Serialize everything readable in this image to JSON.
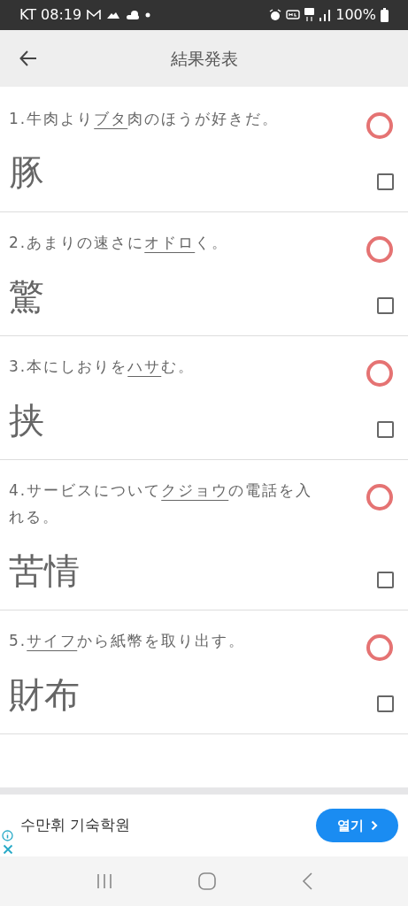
{
  "status_bar": {
    "carrier_time": "KT 08:19",
    "battery": "100%"
  },
  "header": {
    "title": "結果発表"
  },
  "questions": [
    {
      "number": "1.",
      "before": "牛肉より",
      "underlined": "ブタ",
      "after": "肉のほうが好きだ。",
      "answer": "豚",
      "correct": true,
      "checked": false
    },
    {
      "number": "2.",
      "before": "あまりの速さに",
      "underlined": "オドロ",
      "after": "く。",
      "answer": "驚",
      "correct": true,
      "checked": false
    },
    {
      "number": "3.",
      "before": "本にしおりを",
      "underlined": "ハサ",
      "after": "む。",
      "answer": "挟",
      "correct": true,
      "checked": false
    },
    {
      "number": "4.",
      "before": "サービスについて",
      "underlined": "クジョウ",
      "after": "の電話を入れる。",
      "answer": "苦情",
      "correct": true,
      "checked": false
    },
    {
      "number": "5.",
      "underlined": "サイフ",
      "after": "から紙幣を取り出す。",
      "answer": "財布",
      "correct": true,
      "checked": false
    }
  ],
  "ad": {
    "title": "수만휘 기숙학원",
    "button": "열기"
  }
}
